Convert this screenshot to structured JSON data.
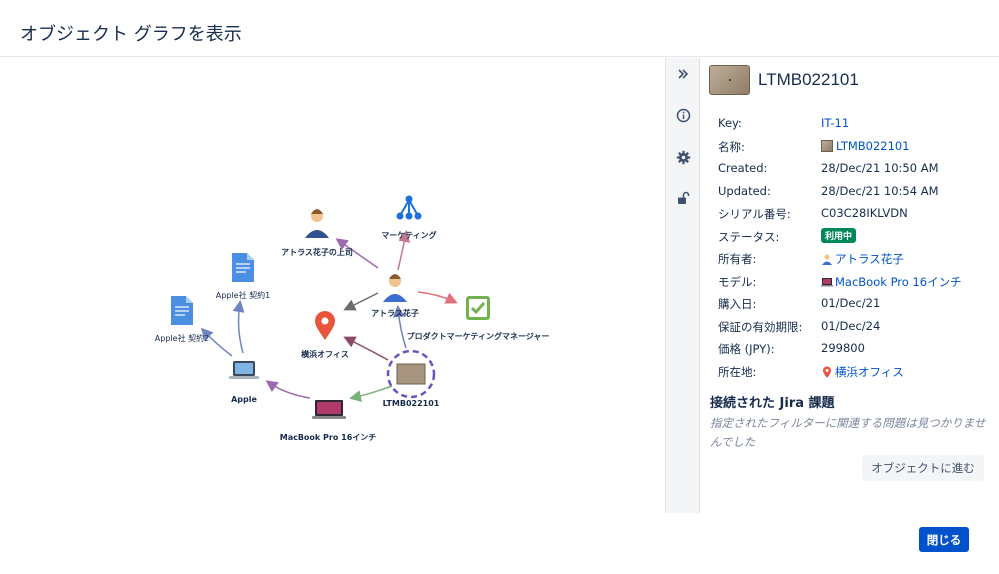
{
  "dialog": {
    "title": "オブジェクト グラフを表示",
    "close_label": "閉じる"
  },
  "graph": {
    "nodes": {
      "person_main": "アトラス花子",
      "boss": "アトラス花子の上司",
      "marketing": "マーケティング",
      "pm": "プロダクトマーケティングマネージャー",
      "office": "横浜オフィス",
      "asset": "LTMB022101",
      "macbook": "MacBook Pro 16インチ",
      "apple": "Apple",
      "contract1": "Apple社 契約1",
      "contract2": "Apple社 契約2"
    },
    "edge_colors": {
      "purple": "#9b6bb0",
      "pink": "#c57a8d",
      "red": "#e0707a",
      "gray": "#6b6b6b",
      "blue": "#6f84c2",
      "green": "#78b07a",
      "maroon": "#8a4b68",
      "highlight": "#6554c0"
    }
  },
  "rail": {
    "expand_icon": "double-chevron-right-icon",
    "info_icon": "info-icon",
    "settings_icon": "gear-icon",
    "lock_icon": "unlock-icon"
  },
  "details": {
    "title": "LTMB022101",
    "attributes": [
      {
        "key": "Key:",
        "value": "IT-11"
      },
      {
        "key": "名称:",
        "value": "LTMB022101"
      },
      {
        "key": "Created:",
        "value": "28/Dec/21 10:50 AM"
      },
      {
        "key": "Updated:",
        "value": "28/Dec/21 10:54 AM"
      },
      {
        "key": "シリアル番号:",
        "value": "C03C28IKLVDN"
      },
      {
        "key": "ステータス:",
        "value": "利用中"
      },
      {
        "key": "所有者:",
        "value": "アトラス花子"
      },
      {
        "key": "モデル:",
        "value": "MacBook Pro 16インチ"
      },
      {
        "key": "購入日:",
        "value": "01/Dec/21"
      },
      {
        "key": "保証の有効期限:",
        "value": "01/Dec/24"
      },
      {
        "key": "価格 (JPY):",
        "value": "299800"
      },
      {
        "key": "所在地:",
        "value": "横浜オフィス"
      }
    ],
    "jira_title": "接続された Jira 課題",
    "jira_empty": "指定されたフィルターに関連する問題は見つかりませんでした",
    "goto_label": "オブジェクトに進む"
  },
  "colors": {
    "primary": "#0052cc",
    "status_green": "#00875a",
    "text": "#172b4d"
  }
}
